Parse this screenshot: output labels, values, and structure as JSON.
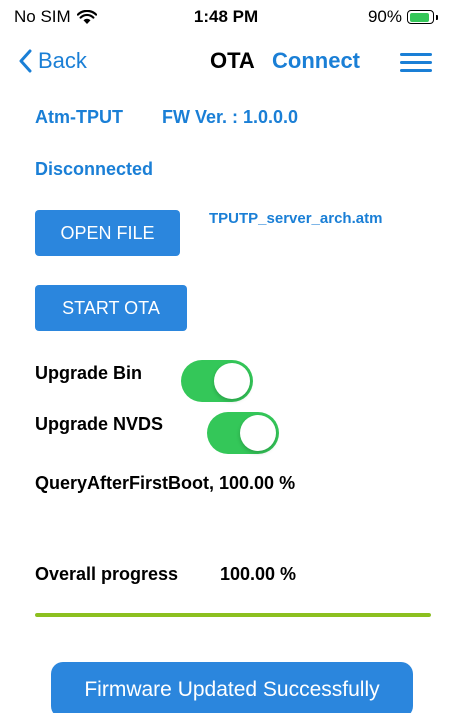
{
  "status_bar": {
    "carrier": "No SIM",
    "time": "1:48 PM",
    "battery": "90%",
    "battery_level": 0.9
  },
  "nav": {
    "back_label": "Back",
    "title": "OTA",
    "connect_label": "Connect"
  },
  "device": {
    "name": "Atm-TPUT",
    "fw_version": "FW Ver. : 1.0.0.0",
    "connection_status": "Disconnected"
  },
  "file": {
    "open_label": "OPEN FILE",
    "file_name": "TPUTP_server_arch.atm"
  },
  "ota": {
    "start_label": "START OTA"
  },
  "toggles": [
    {
      "label": "Upgrade Bin",
      "on": true
    },
    {
      "label": "Upgrade NVDS",
      "on": true
    }
  ],
  "status": {
    "query_text": "QueryAfterFirstBoot, 100.00 %"
  },
  "progress": {
    "label": "Overall progress",
    "value_text": "100.00 %",
    "fraction": 1.0
  },
  "result": {
    "message": "Firmware Updated Successfully"
  },
  "colors": {
    "accent": "#1a7fd6",
    "button": "#2b86dd",
    "toggle_on": "#34c759",
    "progress": "#8cc01f"
  }
}
